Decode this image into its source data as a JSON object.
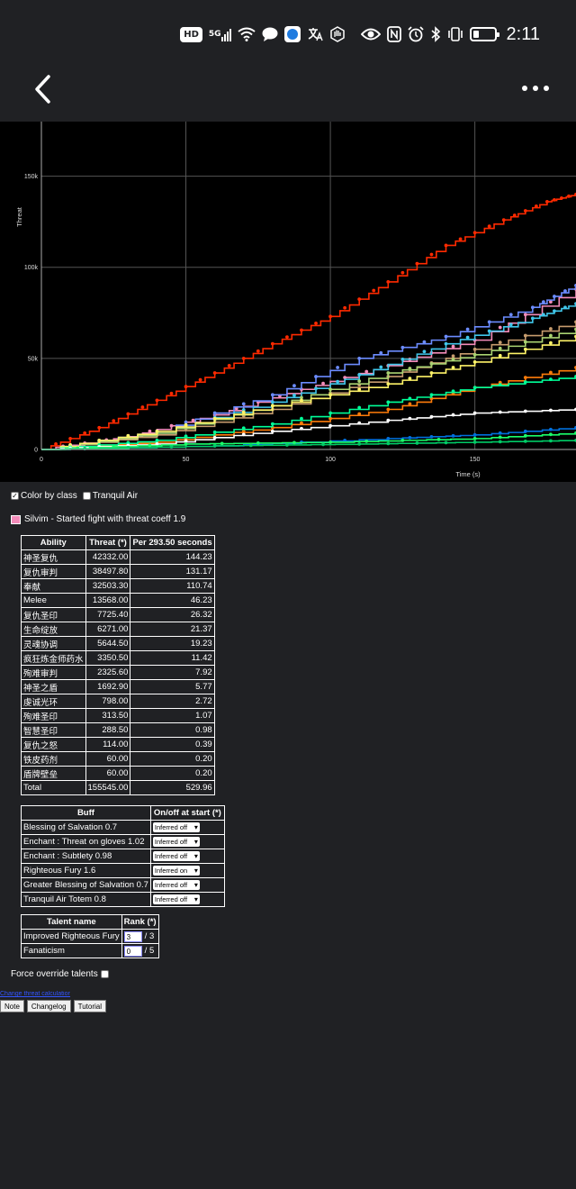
{
  "status_bar": {
    "hd": "HD",
    "network": "5G",
    "time": "2:11",
    "icons": [
      "hd-icon",
      "signal-icon",
      "wifi-icon",
      "message-icon",
      "app-icon",
      "translate-icon",
      "hand-icon",
      "eye-icon",
      "nfc-icon",
      "alarm-icon",
      "bluetooth-icon",
      "vibrate-icon",
      "battery-icon"
    ]
  },
  "nav": {
    "back_icon": "chevron-left-icon",
    "more_icon": "more-dots-icon"
  },
  "chart_data": {
    "type": "line",
    "title": "",
    "xlabel": "Time (s)",
    "ylabel": "Threat",
    "x_ticks": [
      0,
      50,
      100,
      150
    ],
    "x_tick_labels": [
      "0",
      "50",
      "100",
      "150"
    ],
    "y_ticks": [
      0,
      50000,
      100000,
      150000
    ],
    "y_tick_labels": [
      "0",
      "50k",
      "100k",
      "150k"
    ],
    "xlim": [
      0,
      185
    ],
    "ylim": [
      0,
      175000
    ],
    "grid": true,
    "series": [
      {
        "color": "#ff2a00",
        "points": [
          [
            0,
            0
          ],
          [
            20,
            12000
          ],
          [
            40,
            27000
          ],
          [
            60,
            42000
          ],
          [
            80,
            58000
          ],
          [
            100,
            73000
          ],
          [
            120,
            92000
          ],
          [
            140,
            112000
          ],
          [
            160,
            126000
          ],
          [
            175,
            136000
          ],
          [
            185,
            140000
          ]
        ]
      },
      {
        "color": "#f48cba",
        "points": [
          [
            0,
            0
          ],
          [
            30,
            7000
          ],
          [
            60,
            19000
          ],
          [
            90,
            33000
          ],
          [
            120,
            46000
          ],
          [
            150,
            60000
          ],
          [
            185,
            88000
          ]
        ]
      },
      {
        "color": "#6c8cff",
        "points": [
          [
            0,
            0
          ],
          [
            40,
            10000
          ],
          [
            80,
            30000
          ],
          [
            110,
            50000
          ],
          [
            140,
            62000
          ],
          [
            170,
            78000
          ],
          [
            185,
            90000
          ]
        ]
      },
      {
        "color": "#40c7eb",
        "points": [
          [
            0,
            0
          ],
          [
            40,
            9000
          ],
          [
            80,
            26000
          ],
          [
            110,
            41000
          ],
          [
            140,
            58000
          ],
          [
            170,
            72000
          ],
          [
            185,
            80000
          ]
        ]
      },
      {
        "color": "#c79c6e",
        "points": [
          [
            0,
            0
          ],
          [
            40,
            8000
          ],
          [
            80,
            22000
          ],
          [
            120,
            40000
          ],
          [
            150,
            55000
          ],
          [
            185,
            70000
          ]
        ]
      },
      {
        "color": "#aad372",
        "points": [
          [
            0,
            0
          ],
          [
            40,
            9000
          ],
          [
            80,
            24000
          ],
          [
            120,
            42000
          ],
          [
            150,
            52000
          ],
          [
            185,
            66000
          ]
        ]
      },
      {
        "color": "#fff468",
        "points": [
          [
            0,
            0
          ],
          [
            40,
            10000
          ],
          [
            80,
            24000
          ],
          [
            120,
            36000
          ],
          [
            150,
            48000
          ],
          [
            185,
            62000
          ]
        ]
      },
      {
        "color": "#ff7c0a",
        "points": [
          [
            0,
            0
          ],
          [
            40,
            4000
          ],
          [
            80,
            12000
          ],
          [
            120,
            22000
          ],
          [
            150,
            34000
          ],
          [
            185,
            45000
          ]
        ]
      },
      {
        "color": "#00ff98",
        "points": [
          [
            0,
            0
          ],
          [
            40,
            5000
          ],
          [
            80,
            14000
          ],
          [
            120,
            26000
          ],
          [
            150,
            34000
          ],
          [
            185,
            40000
          ]
        ]
      },
      {
        "color": "#ffffff",
        "points": [
          [
            0,
            0
          ],
          [
            40,
            3000
          ],
          [
            80,
            10000
          ],
          [
            120,
            16000
          ],
          [
            150,
            20000
          ],
          [
            185,
            22000
          ]
        ]
      },
      {
        "color": "#0070dd",
        "points": [
          [
            0,
            0
          ],
          [
            60,
            2000
          ],
          [
            120,
            6000
          ],
          [
            150,
            8000
          ],
          [
            185,
            12000
          ]
        ]
      },
      {
        "color": "#1aff6a",
        "points": [
          [
            0,
            0
          ],
          [
            50,
            3000
          ],
          [
            100,
            4000
          ],
          [
            150,
            6000
          ],
          [
            185,
            9000
          ]
        ]
      },
      {
        "color": "#00cc66",
        "points": [
          [
            0,
            0
          ],
          [
            60,
            2000
          ],
          [
            110,
            3000
          ],
          [
            150,
            4000
          ],
          [
            185,
            5000
          ]
        ]
      }
    ]
  },
  "controls": {
    "color_by_class_label": "Color by class",
    "color_by_class_checked": true,
    "tranquil_air_label": "Tranquil Air",
    "tranquil_air_checked": false
  },
  "player": {
    "text": "Silvim - Started fight with threat coeff 1.9",
    "color": "#f48cba"
  },
  "ability_table": {
    "headers": [
      "Ability",
      "Threat (*)",
      "Per 293.50 seconds"
    ],
    "rows": [
      [
        "神圣复仇",
        "42332.00",
        "144.23"
      ],
      [
        "复仇审判",
        "38497.80",
        "131.17"
      ],
      [
        "奉献",
        "32503.30",
        "110.74"
      ],
      [
        "Melee",
        "13568.00",
        "46.23"
      ],
      [
        "复仇圣印",
        "7725.40",
        "26.32"
      ],
      [
        "生命绽放",
        "6271.00",
        "21.37"
      ],
      [
        "灵魂协调",
        "5644.50",
        "19.23"
      ],
      [
        "疯狂炼金师药水",
        "3350.50",
        "11.42"
      ],
      [
        "殉难审判",
        "2325.60",
        "7.92"
      ],
      [
        "神圣之盾",
        "1692.90",
        "5.77"
      ],
      [
        "虔诚光环",
        "798.00",
        "2.72"
      ],
      [
        "殉难圣印",
        "313.50",
        "1.07"
      ],
      [
        "智慧圣印",
        "288.50",
        "0.98"
      ],
      [
        "复仇之怒",
        "114.00",
        "0.39"
      ],
      [
        "铁皮药剂",
        "60.00",
        "0.20"
      ],
      [
        "盾牌壁垒",
        "60.00",
        "0.20"
      ],
      [
        "Total",
        "155545.00",
        "529.96"
      ]
    ]
  },
  "buff_table": {
    "headers": [
      "Buff",
      "On/off at start (*)"
    ],
    "rows": [
      [
        "Blessing of Salvation 0.7",
        "Inferred off"
      ],
      [
        "Enchant : Threat on gloves 1.02",
        "Inferred off"
      ],
      [
        "Enchant : Subtlety 0.98",
        "Inferred off"
      ],
      [
        "Righteous Fury 1.6",
        "Inferred on"
      ],
      [
        "Greater Blessing of Salvation 0.7",
        "Inferred off"
      ],
      [
        "Tranquil Air Totem 0.8",
        "Inferred off"
      ]
    ]
  },
  "talent_table": {
    "headers": [
      "Talent name",
      "Rank (*)"
    ],
    "rows": [
      {
        "name": "Improved Righteous Fury",
        "value": "3",
        "max": "/ 3"
      },
      {
        "name": "Fanaticism",
        "value": "0",
        "max": "/ 5"
      }
    ]
  },
  "force_override_label": "Force override talents",
  "link_text": "Change threat calculation",
  "buttons": [
    "Note",
    "Changelog",
    "Tutorial"
  ]
}
